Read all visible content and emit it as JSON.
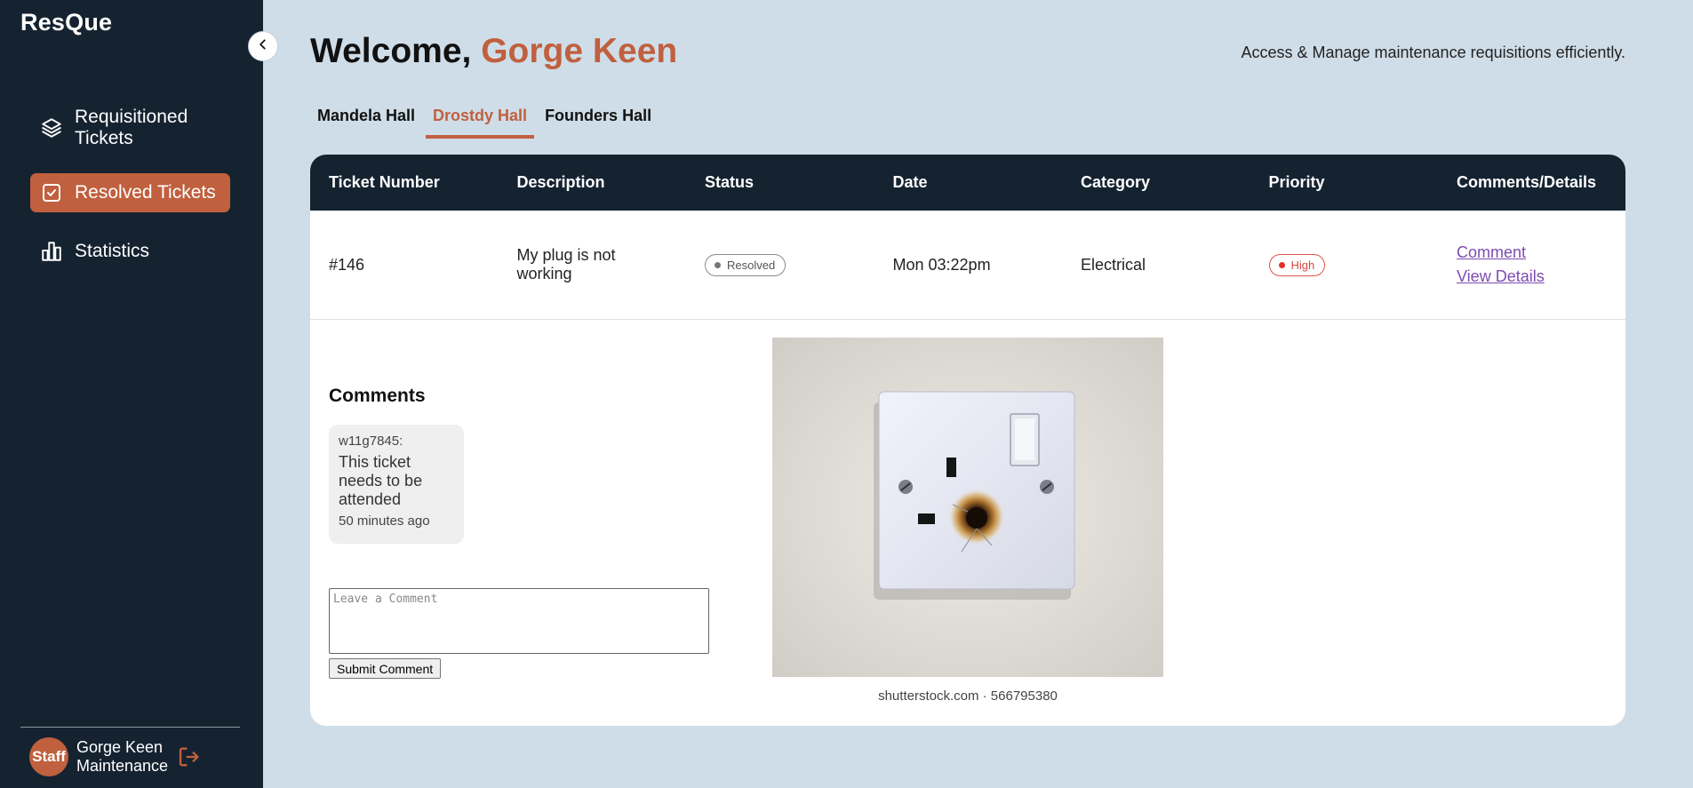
{
  "app": {
    "brand": "ResQue"
  },
  "sidebar": {
    "items": [
      {
        "label": "Requisitioned Tickets",
        "icon": "layers-icon"
      },
      {
        "label": "Resolved Tickets",
        "icon": "checkbox-icon",
        "active": true
      },
      {
        "label": "Statistics",
        "icon": "bar-chart-icon"
      }
    ],
    "user": {
      "avatar_text": "Staff",
      "name": "Gorge Keen",
      "role": "Maintenance"
    }
  },
  "header": {
    "welcome_prefix": "Welcome,",
    "user_name": "Gorge Keen",
    "tagline": "Access & Manage maintenance requisitions efficiently."
  },
  "tabs": [
    {
      "label": "Mandela Hall",
      "active": false
    },
    {
      "label": "Drostdy Hall",
      "active": true
    },
    {
      "label": "Founders Hall",
      "active": false
    }
  ],
  "table": {
    "columns": [
      "Ticket Number",
      "Description",
      "Status",
      "Date",
      "Category",
      "Priority",
      "Comments/Details"
    ],
    "rows": [
      {
        "ticket": "#146",
        "description": "My plug is not working",
        "status": "Resolved",
        "date": "Mon 03:22pm",
        "category": "Electrical",
        "priority": "High",
        "comment_link": "Comment",
        "details_link": "View Details"
      }
    ]
  },
  "comments": {
    "title": "Comments",
    "items": [
      {
        "user": "w11g7845:",
        "text": "This ticket needs to be attended",
        "time": "50 minutes ago"
      }
    ],
    "input_placeholder": "Leave a Comment",
    "submit_label": "Submit Comment"
  },
  "image": {
    "caption": "shutterstock.com · 566795380"
  },
  "colors": {
    "accent": "#c0603e",
    "sidebar": "#152331",
    "background": "#cfdde8",
    "link": "#7d4cb3",
    "priority": "#e0302a"
  }
}
